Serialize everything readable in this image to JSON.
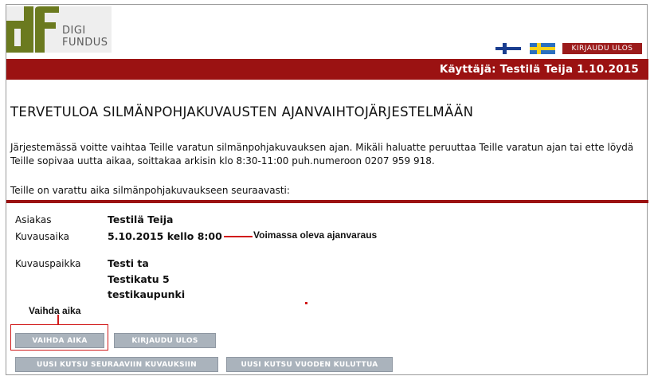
{
  "header": {
    "logo_line1": "DIGI",
    "logo_line2": "FUNDUS",
    "logout_label": "KIRJAUDU ULOS",
    "user_bar_text": "Käyttäjä: Testilä Teija 1.10.2015"
  },
  "main": {
    "title": "TERVETULOA SILMÄNPOHJAKUVAUSTEN AJANVAIHTOJÄRJESTELMÄÄN",
    "intro": "Järjestemässä voitte vaihtaa Teille varatun silmänpohjakuvauksen ajan. Mikäli haluatte peruuttaa Teille varatun ajan tai ette löydä Teille sopivaa uutta aikaa, soittakaa arkisin klo 8:30-11:00 puh.numeroon 0207 959 918.",
    "booked_line": "Teille on varattu aika silmänpohjakuvaukseen seuraavasti:"
  },
  "details": {
    "client_label": "Asiakas",
    "client_value": "Testilä Teija",
    "time_label": "Kuvausaika",
    "time_value": "5.10.2015 kello 8:00",
    "place_label": "Kuvauspaikka",
    "place_line1": "Testi ta",
    "place_line2": "Testikatu 5",
    "place_line3": "testikaupunki"
  },
  "annotations": {
    "current_booking": "Voimassa oleva ajanvaraus",
    "change_time": "Vaihda aika"
  },
  "buttons": {
    "change_time": "VAIHDA AIKA",
    "logout": "KIRJAUDU ULOS",
    "next_invitation": "UUSI KUTSU SEURAAVIIN KUVAUKSIIN",
    "year_invitation": "UUSI KUTSU VUODEN KULUTTUA"
  },
  "colors": {
    "brand_red": "#9b1212",
    "button_gray": "#aab3bc",
    "logo_green": "#6b7a1f",
    "annotation_red": "#d11a1a"
  }
}
